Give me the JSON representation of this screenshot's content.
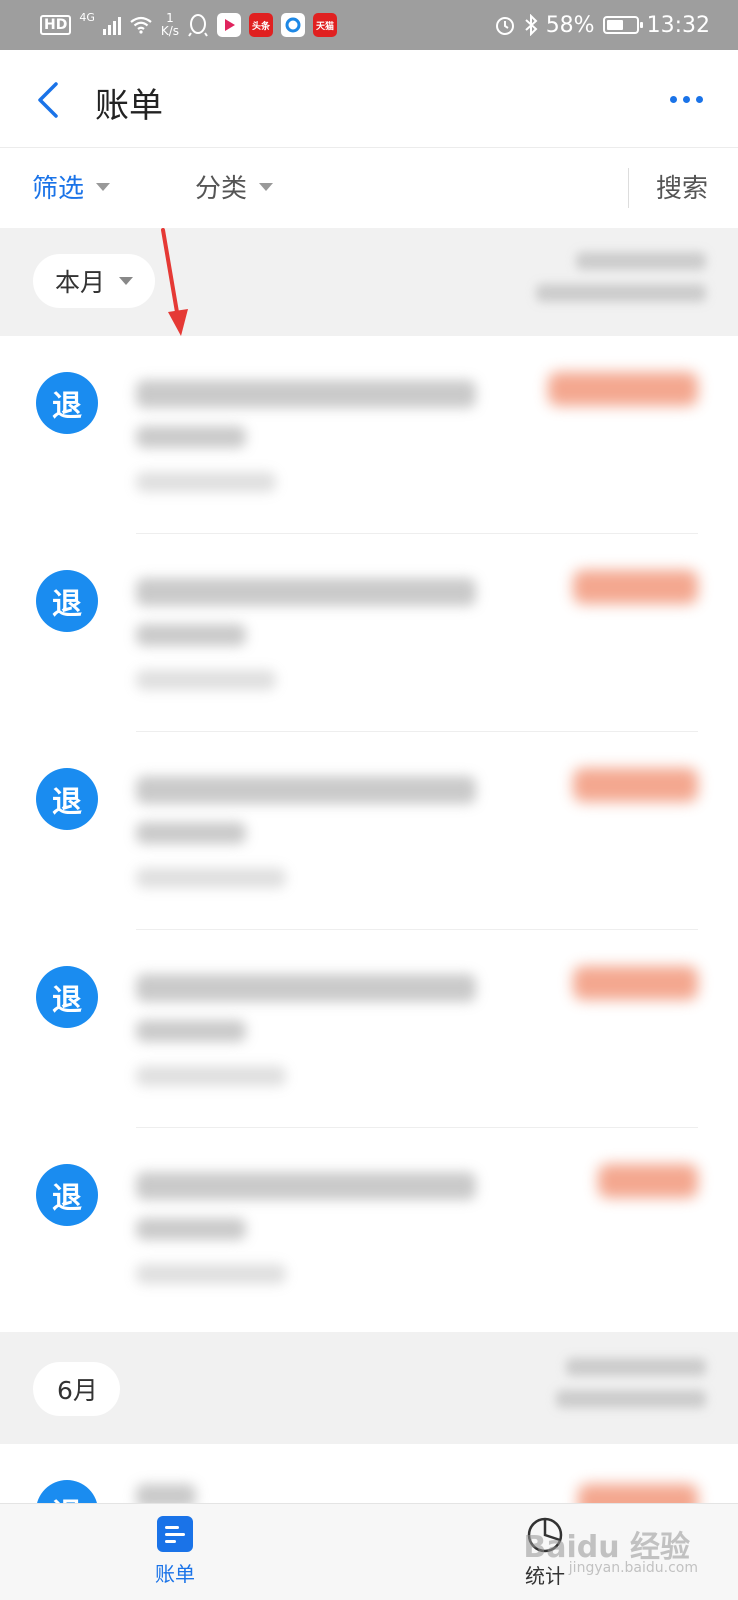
{
  "status_bar": {
    "hd": "HD",
    "signal": "4G",
    "speed_value": "1",
    "speed_unit": "K/s",
    "apps": [
      {
        "name": "qq-icon",
        "label": ""
      },
      {
        "name": "video-app-icon",
        "label": ""
      },
      {
        "name": "toutiao-icon",
        "label": "头条"
      },
      {
        "name": "browser-app-icon",
        "label": ""
      },
      {
        "name": "tmall-icon",
        "label": "天猫"
      }
    ],
    "battery": "58%",
    "battery_level": 0.58,
    "time": "13:32"
  },
  "header": {
    "title": "账单"
  },
  "filter_bar": {
    "filter": "筛选",
    "category": "分类",
    "search": "搜索"
  },
  "sections": [
    {
      "month": "本月"
    },
    {
      "month": "6月"
    }
  ],
  "transaction_icon": "退",
  "bottom_nav": {
    "bill": "账单",
    "stats": "统计"
  },
  "watermark": {
    "text": "Baidu 经验",
    "sub": "jingyan.baidu.com"
  },
  "colors": {
    "accent": "#1a73e8",
    "icon_bg": "#1a8cf0",
    "amount": "#f08a6a"
  }
}
